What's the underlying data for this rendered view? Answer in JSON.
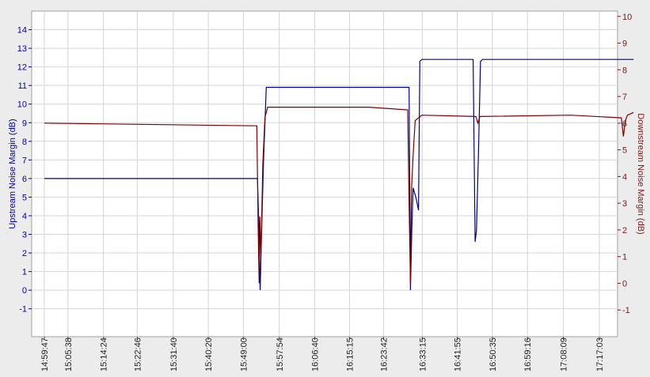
{
  "chart_data": {
    "type": "line",
    "ylabel_left": "Upstream Noise Margin (dB)",
    "ylabel_right": "Downstream Noise Margin (dB)",
    "left_ticks": [
      "-1",
      "0",
      "1",
      "2",
      "3",
      "4",
      "5",
      "6",
      "7",
      "8",
      "9",
      "10",
      "11",
      "12",
      "13",
      "14"
    ],
    "right_ticks": [
      "-1",
      "0",
      "1",
      "2",
      "3",
      "4",
      "5",
      "6",
      "7",
      "8",
      "9",
      "10"
    ],
    "ylim_left": [
      -2.5,
      15
    ],
    "ylim_right": [
      -2,
      10.2
    ],
    "x_tick_labels": [
      "14:59:47",
      "15:05:38",
      "15:14:24",
      "15:22:46",
      "15:31:40",
      "15:40:20",
      "15:49:00",
      "15:57:54",
      "16:06:40",
      "16:15:15",
      "16:23:42",
      "16:33:15",
      "16:41:55",
      "16:50:35",
      "16:59:16",
      "17:08:09",
      "17:17:03"
    ],
    "xlim": [
      "14:59:47",
      "17:28:00"
    ],
    "grid": true,
    "colors": {
      "upstream": "#00008b",
      "downstream": "#7a0000",
      "left_axis": "#0000aa",
      "right_axis": "#7a1a1a",
      "grid": "#d4d4d4",
      "plot_bg": "#ffffff",
      "frame": "#a0a0a0"
    },
    "series": [
      {
        "key": "upstream",
        "x": [
          "14:59:47",
          "15:52:30",
          "15:52:50",
          "15:53:10",
          "15:53:30",
          "15:54:00",
          "15:54:40",
          "16:30:00",
          "16:30:20",
          "16:30:40",
          "16:31:00",
          "16:31:40",
          "16:32:20",
          "16:32:40",
          "16:33:10",
          "16:45:50",
          "16:46:20",
          "16:46:40",
          "16:47:10",
          "16:47:40",
          "16:48:10",
          "17:25:30"
        ],
        "y": [
          6.0,
          6.0,
          3.5,
          0.0,
          3.0,
          7.0,
          10.9,
          10.9,
          0.0,
          3.2,
          5.5,
          5.0,
          4.3,
          12.3,
          12.4,
          12.4,
          2.6,
          3.2,
          7.5,
          12.3,
          12.4,
          12.4
        ]
      },
      {
        "key": "downstream",
        "x": [
          "14:59:47",
          "15:52:20",
          "15:52:40",
          "15:52:55",
          "15:53:05",
          "15:53:20",
          "15:53:50",
          "15:54:20",
          "15:55:00",
          "16:08:00",
          "16:20:00",
          "16:29:40",
          "16:30:00",
          "16:30:20",
          "16:30:35",
          "16:31:00",
          "16:31:30",
          "16:32:20",
          "16:33:10",
          "16:46:30",
          "16:47:00",
          "16:47:30",
          "17:10:00",
          "17:22:30",
          "17:23:00",
          "17:23:30",
          "17:24:00",
          "17:25:30"
        ],
        "y": [
          6.0,
          5.9,
          2.0,
          0.0,
          2.5,
          1.0,
          4.5,
          6.2,
          6.6,
          6.6,
          6.6,
          6.5,
          3.0,
          0.0,
          3.5,
          4.8,
          6.1,
          6.2,
          6.3,
          6.25,
          6.0,
          6.25,
          6.3,
          6.2,
          5.5,
          6.1,
          6.3,
          6.4
        ]
      }
    ]
  }
}
